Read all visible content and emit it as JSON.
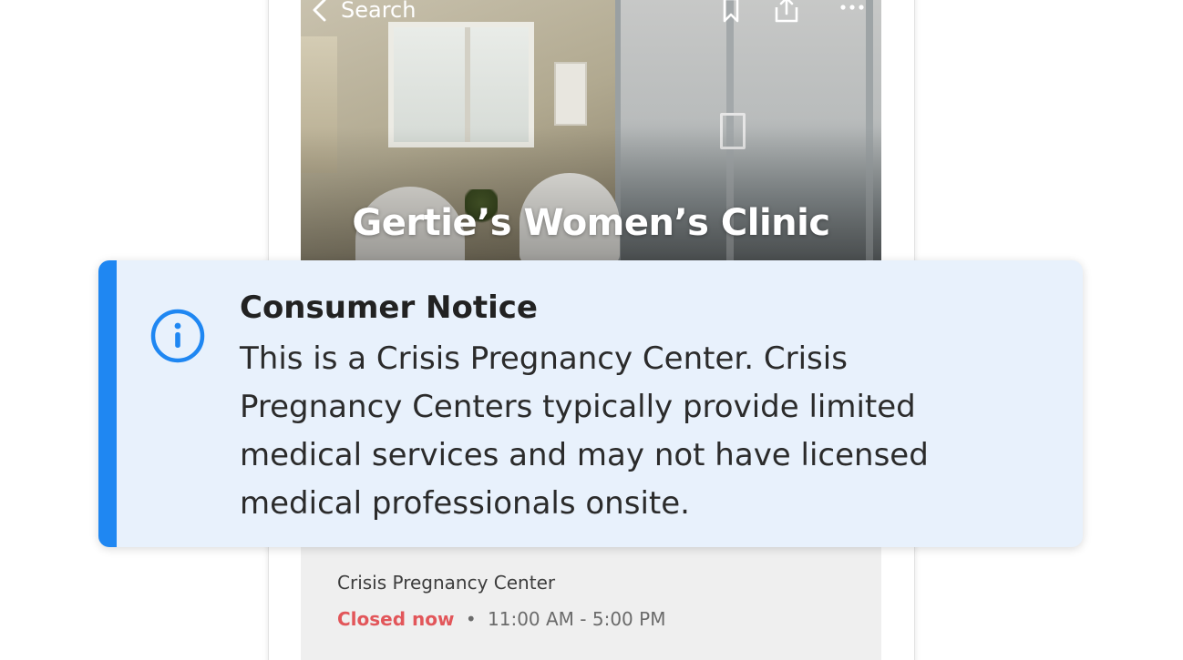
{
  "nav": {
    "back_label": "Search"
  },
  "listing": {
    "name": "Gertie’s Women’s Clinic",
    "category": "Crisis Pregnancy Center",
    "status": "Closed now",
    "separator": "•",
    "hours": "11:00 AM - 5:00 PM"
  },
  "notice": {
    "title": "Consumer Notice",
    "body_lines": [
      "This is a Crisis Pregnancy Center. Crisis",
      "Pregnancy Centers typically provide limited",
      "medical services and may not have licensed",
      "medical professionals onsite."
    ]
  },
  "icons": {
    "back": "chevron-left-icon",
    "bookmark": "bookmark-icon",
    "share": "share-icon",
    "more": "more-horizontal-icon",
    "info": "info-circle-icon"
  },
  "colors": {
    "accent": "#1f87f2",
    "notice_bg": "#e8f1fc",
    "closed": "#e2565a",
    "details_bg": "#efefef"
  }
}
